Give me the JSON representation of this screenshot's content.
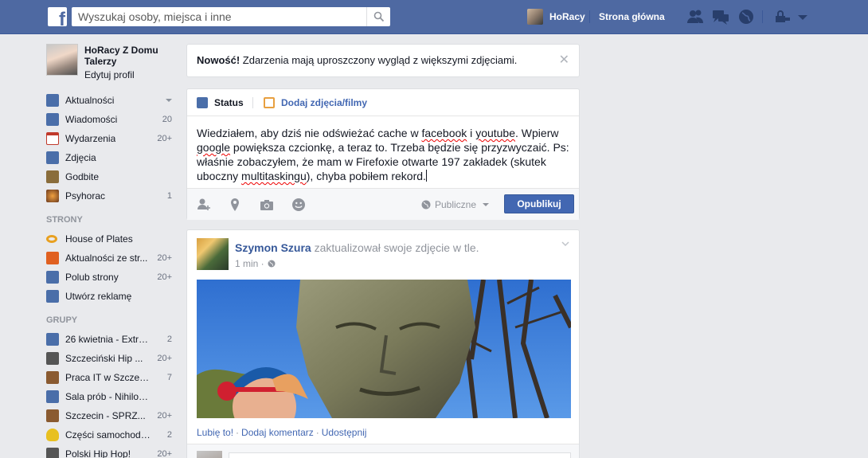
{
  "topbar": {
    "logo": "f",
    "search_placeholder": "Wyszukaj osoby, miejsca i inne",
    "user_name": "HoRacy",
    "home_label": "Strona główna",
    "icons": [
      "friends-icon",
      "messages-icon",
      "notifications-icon",
      "privacy-icon",
      "account-menu-icon"
    ]
  },
  "profile": {
    "name": "HoRacy Z Domu Talerzy",
    "edit_label": "Edytuj profil"
  },
  "nav_favorites": [
    {
      "label": "Aktualności",
      "count": "",
      "icon": "news-feed-icon",
      "color": "#4a6ea9"
    },
    {
      "label": "Wiadomości",
      "count": "20",
      "icon": "messages-icon",
      "color": "#4a6ea9"
    },
    {
      "label": "Wydarzenia",
      "count": "20+",
      "icon": "calendar-icon",
      "color": "#c0392b"
    },
    {
      "label": "Zdjęcia",
      "count": "",
      "icon": "photos-icon",
      "color": "#4a6ea9"
    },
    {
      "label": "Godbite",
      "count": "",
      "icon": "app-icon",
      "color": "#8a6d3b"
    },
    {
      "label": "Psyhorac",
      "count": "1",
      "icon": "app-icon",
      "color": "#6b3a1e"
    }
  ],
  "section_pages": "STRONY",
  "nav_pages": [
    {
      "label": "House of Plates",
      "count": "",
      "icon": "page-icon",
      "color": "#e8a020"
    },
    {
      "label": "Aktualności ze str...",
      "count": "20+",
      "icon": "pages-feed-icon",
      "color": "#e06020"
    },
    {
      "label": "Polub strony",
      "count": "20+",
      "icon": "like-pages-icon",
      "color": "#4a6ea9"
    },
    {
      "label": "Utwórz reklamę",
      "count": "",
      "icon": "ads-icon",
      "color": "#4a6ea9"
    }
  ],
  "section_groups": "GRUPY",
  "nav_groups": [
    {
      "label": "26 kwietnia - Extre...",
      "count": "2",
      "icon": "group-icon",
      "color": "#4a6ea9"
    },
    {
      "label": "Szczeciński Hip ...",
      "count": "20+",
      "icon": "music-icon",
      "color": "#555555"
    },
    {
      "label": "Praca IT w Szczecinie",
      "count": "7",
      "icon": "briefcase-icon",
      "color": "#8a5a30"
    },
    {
      "label": "Sala prób - Nihilosau...",
      "count": "",
      "icon": "group-icon",
      "color": "#4a6ea9"
    },
    {
      "label": "Szczecin - SPRZ...",
      "count": "20+",
      "icon": "gavel-icon",
      "color": "#8a5a30"
    },
    {
      "label": "Części samochodo...",
      "count": "2",
      "icon": "lightbulb-icon",
      "color": "#e8c020"
    },
    {
      "label": "Polski Hip Hop!",
      "count": "20+",
      "icon": "music-icon",
      "color": "#555555"
    }
  ],
  "notice": {
    "bold": "Nowość!",
    "text": " Zdarzenia mają uproszczony wygląd z większymi zdjęciami."
  },
  "composer": {
    "tab_status": "Status",
    "tab_photos": "Dodaj zdjęcia/filmy",
    "text_1": "Wiedziałem, aby dziś nie odświeżać cache w ",
    "sq_1": "facebook",
    "text_2": " i ",
    "sq_2": "youtube",
    "text_3": ". Wpierw ",
    "sq_3": "google",
    "text_4": " powiększa czcionkę, a teraz to. Trzeba będzie się przyzwyczaić. Ps: właśnie zobaczyłem, że mam w Firefoxie otwarte 197 zakładek (skutek uboczny ",
    "sq_4": "multitaskingu",
    "text_5": "), chyba pobiłem rekord.",
    "privacy": "Publiczne",
    "publish": "Opublikuj"
  },
  "post": {
    "author": "Szymon Szura",
    "action": " zaktualizował swoje zdjęcie w tle.",
    "time": "1 min · ",
    "like": "Lubię to!",
    "comment": "Dodaj komentarz",
    "share": "Udostępnij",
    "sep": "·"
  }
}
